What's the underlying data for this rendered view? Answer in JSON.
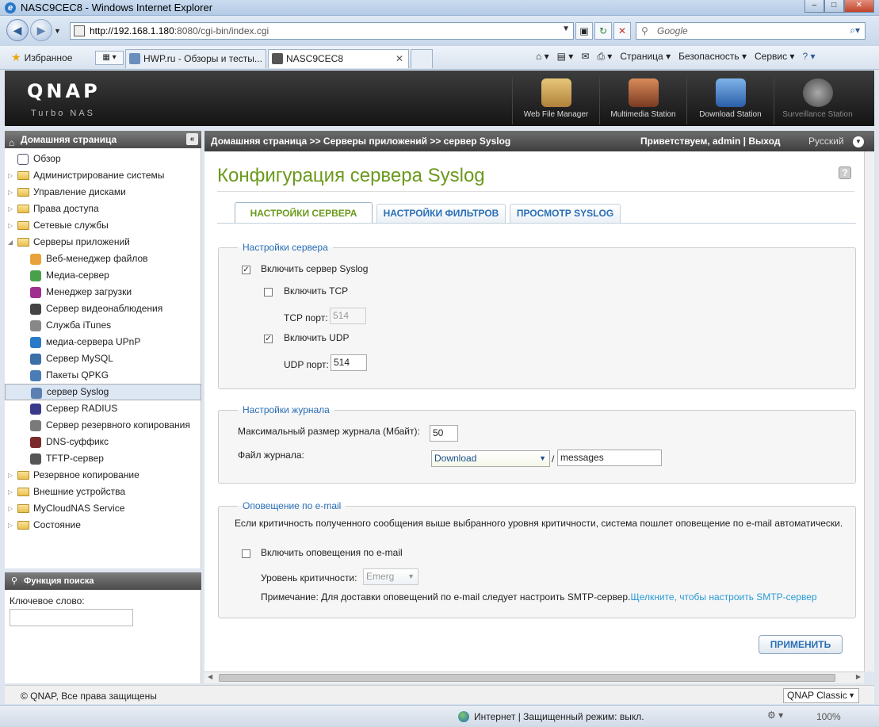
{
  "window": {
    "title": "NASC9CEC8 - Windows Internet Explorer"
  },
  "browser": {
    "url_host": "http://192.168.1.180",
    "url_rest": ":8080/cgi-bin/index.cgi",
    "search_placeholder": "Google",
    "favorites_label": "Избранное",
    "tabs": [
      {
        "label": "HWP.ru - Обзоры и тесты..."
      },
      {
        "label": "NASC9CEC8"
      }
    ],
    "commands": [
      "Страница",
      "Безопасность",
      "Сервис"
    ]
  },
  "qnap": {
    "logo": "QNAP",
    "subtitle": "Turbo NAS",
    "apps": [
      {
        "label": "Web File Manager",
        "color": "#c9a55a"
      },
      {
        "label": "Multimedia Station",
        "color": "#b05a3c"
      },
      {
        "label": "Download Station",
        "color": "#3a7dc8"
      },
      {
        "label": "Surveillance Station",
        "color": "#888888"
      }
    ]
  },
  "sidebar": {
    "header": "Домашняя страница",
    "items": [
      {
        "label": "Обзор",
        "level": 0,
        "kind": "page"
      },
      {
        "label": "Администрирование системы",
        "level": 0,
        "kind": "folder"
      },
      {
        "label": "Управление дисками",
        "level": 0,
        "kind": "folder"
      },
      {
        "label": "Права доступа",
        "level": 0,
        "kind": "folder"
      },
      {
        "label": "Сетевые службы",
        "level": 0,
        "kind": "folder"
      },
      {
        "label": "Серверы приложений",
        "level": 0,
        "kind": "folder-open"
      },
      {
        "label": "Веб-менеджер файлов",
        "level": 1,
        "kind": "app"
      },
      {
        "label": "Медиа-сервер",
        "level": 1,
        "kind": "app"
      },
      {
        "label": "Менеджер загрузки",
        "level": 1,
        "kind": "app"
      },
      {
        "label": "Сервер видеонаблюдения",
        "level": 1,
        "kind": "app"
      },
      {
        "label": "Служба iTunes",
        "level": 1,
        "kind": "app"
      },
      {
        "label": "медиа-сервера UPnP",
        "level": 1,
        "kind": "app"
      },
      {
        "label": "Сервер MySQL",
        "level": 1,
        "kind": "app"
      },
      {
        "label": "Пакеты QPKG",
        "level": 1,
        "kind": "app"
      },
      {
        "label": "сервер Syslog",
        "level": 1,
        "kind": "app",
        "selected": true
      },
      {
        "label": "Сервер RADIUS",
        "level": 1,
        "kind": "app"
      },
      {
        "label": "Сервер резервного копирования",
        "level": 1,
        "kind": "app"
      },
      {
        "label": "DNS-суффикс",
        "level": 1,
        "kind": "app"
      },
      {
        "label": "TFTP-сервер",
        "level": 1,
        "kind": "app"
      },
      {
        "label": "Резервное копирование",
        "level": 0,
        "kind": "folder"
      },
      {
        "label": "Внешние устройства",
        "level": 0,
        "kind": "folder"
      },
      {
        "label": "MyCloudNAS Service",
        "level": 0,
        "kind": "folder"
      },
      {
        "label": "Состояние",
        "level": 0,
        "kind": "folder"
      }
    ],
    "search": {
      "header": "Функция поиска",
      "keyword_label": "Ключевое слово:"
    }
  },
  "main": {
    "breadcrumb": "Домашняя страница >> Серверы приложений >> сервер Syslog",
    "welcome": "Приветствуем, admin | Выход",
    "language": "Русский",
    "title": "Конфигурация сервера Syslog",
    "tabs": [
      {
        "label": "НАСТРОЙКИ СЕРВЕРА",
        "active": true
      },
      {
        "label": "НАСТРОЙКИ ФИЛЬТРОВ",
        "active": false
      },
      {
        "label": "ПРОСМОТР SYSLOG",
        "active": false
      }
    ],
    "server_settings": {
      "legend": "Настройки сервера",
      "enable_syslog": {
        "label": "Включить сервер Syslog",
        "checked": true
      },
      "enable_tcp": {
        "label": "Включить TCP",
        "checked": false
      },
      "tcp_port": {
        "label": "TCP порт:",
        "value": "514"
      },
      "enable_udp": {
        "label": "Включить UDP",
        "checked": true
      },
      "udp_port": {
        "label": "UDP порт:",
        "value": "514"
      }
    },
    "log_settings": {
      "legend": "Настройки журнала",
      "max_size_label": "Максимальный размер журнала (Мбайт):",
      "max_size_value": "50",
      "file_label": "Файл журнала:",
      "file_folder": "Download",
      "separator": "/",
      "file_name": "messages"
    },
    "email": {
      "legend": "Оповещение по e-mail",
      "description": "Если критичность полученного сообщения выше выбранного уровня критичности, система пошлет оповещение по e-mail автоматически.",
      "enable_label": "Включить оповещения по e-mail",
      "enable_checked": false,
      "level_label": "Уровень критичности:",
      "level_value": "Emerg",
      "note": "Примечание: Для доставки оповещений по e-mail следует настроить SMTP-сервер.",
      "note_link": "Щелкните, чтобы настроить SMTP-сервер"
    },
    "apply_label": "ПРИМЕНИТЬ"
  },
  "footer": {
    "copyright": "© QNAP, Все права защищены",
    "theme": "QNAP Classic"
  },
  "status": {
    "zone": "Интернет | Защищенный режим: выкл.",
    "zoom": "100%"
  }
}
